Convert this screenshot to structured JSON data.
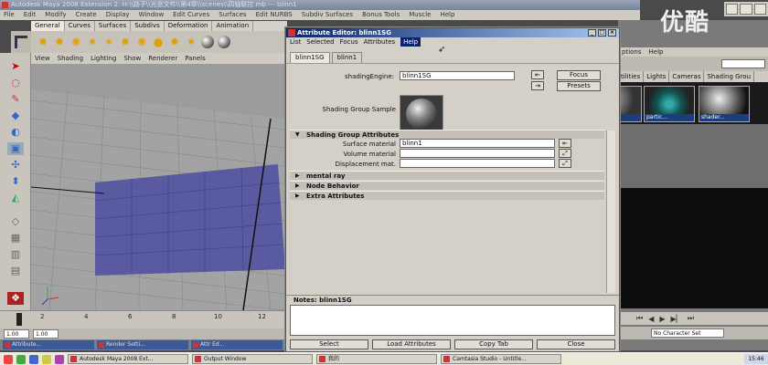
{
  "maya": {
    "title": "Autodesk Maya 2008 Extension 2: H:\\\\路子\\\\光盘文件\\\\第4章\\\\scenes\\\\四轴联控.mb  ---  blinn1",
    "menus": [
      "File",
      "Edit",
      "Modify",
      "Create",
      "Display",
      "Window",
      "Edit Curves",
      "Surfaces",
      "Edit NURBS",
      "Subdiv Surfaces",
      "Bonus Tools",
      "Muscle",
      "Help"
    ],
    "shelf_tabs": [
      "General",
      "Curves",
      "Surfaces",
      "Subdivs",
      "Deformation",
      "Animation"
    ],
    "viewport_menus": [
      "View",
      "Shading",
      "Lighting",
      "Show",
      "Renderer",
      "Panels"
    ],
    "timeline_ticks": [
      "2",
      "4",
      "6",
      "8",
      "10",
      "12"
    ],
    "range_start": "1.00",
    "range_current": "1.00",
    "inner_tasks": [
      "Attribute...",
      "Render Setti...",
      "Attr Ed..."
    ]
  },
  "attribute_editor": {
    "title": "Attribute Editor: blinn1SG",
    "menus": [
      "List",
      "Selected",
      "Focus",
      "Attributes",
      "Help"
    ],
    "tabs": [
      "blinn1SG",
      "blinn1"
    ],
    "shading_engine_label": "shadingEngine:",
    "shading_engine_value": "blinn1SG",
    "focus_label": "Focus",
    "presets_label": "Presets",
    "sample_label": "Shading Group Sample",
    "sections": {
      "shading_group": "Shading Group Attributes",
      "mental_ray": "mental ray",
      "node_behavior": "Node Behavior",
      "extra": "Extra Attributes"
    },
    "fields": {
      "surface_label": "Surface material",
      "surface_value": "blinn1",
      "volume_label": "Volume material",
      "volume_value": "",
      "displacement_label": "Displacement mat.",
      "displacement_value": ""
    },
    "notes_label": "Notes:  blinn1SG",
    "buttons": {
      "select": "Select",
      "load": "Load Attributes",
      "copy": "Copy Tab",
      "close": "Close"
    }
  },
  "hypershade": {
    "menu_items": [
      "ptions",
      "Help"
    ],
    "tabs": [
      "tilities",
      "Lights",
      "Cameras",
      "Shading Grou"
    ],
    "swatches": [
      "...tl",
      "partic...",
      "shader..."
    ],
    "charset": "No Character Set"
  },
  "logo": "优酷",
  "taskbar": {
    "tasks": [
      "Autodesk Maya 2008 Ext...",
      "Output Window",
      "我的",
      "Camtasia Studio - Untitle..."
    ],
    "clock": "15:46"
  }
}
